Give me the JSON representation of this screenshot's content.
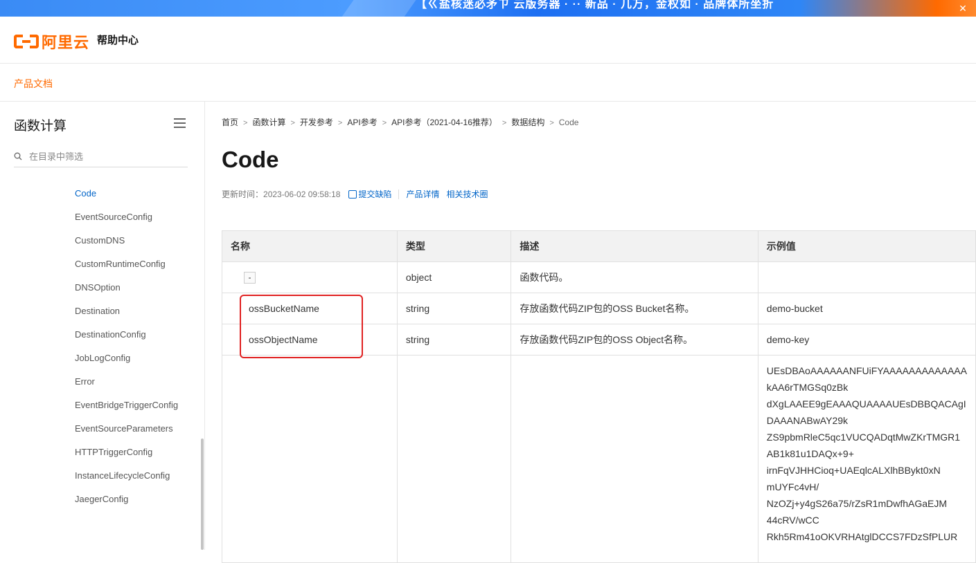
{
  "banner": {
    "text": "【ㄍ盐核迷必矛ㄗ 云版务器 · ·· 新品 · 几万，金权如 · 品牌体所坐折",
    "close_icon": "close-icon"
  },
  "header": {
    "brand": "阿里云",
    "help_center": "帮助中心"
  },
  "docsbar": {
    "product_docs": "产品文档"
  },
  "sidebar": {
    "title": "函数计算",
    "filter_placeholder": "在目录中筛选",
    "items": [
      {
        "label": "Code",
        "active": true
      },
      {
        "label": "EventSourceConfig"
      },
      {
        "label": "CustomDNS"
      },
      {
        "label": "CustomRuntimeConfig"
      },
      {
        "label": "DNSOption"
      },
      {
        "label": "Destination"
      },
      {
        "label": "DestinationConfig"
      },
      {
        "label": "JobLogConfig"
      },
      {
        "label": "Error"
      },
      {
        "label": "EventBridgeTriggerConfig"
      },
      {
        "label": "EventSourceParameters"
      },
      {
        "label": "HTTPTriggerConfig"
      },
      {
        "label": "InstanceLifecycleConfig"
      },
      {
        "label": "JaegerConfig"
      }
    ]
  },
  "breadcrumb": [
    "首页",
    "函数计算",
    "开发参考",
    "API参考",
    "API参考（2021-04-16推荐）",
    "数据结构",
    "Code"
  ],
  "page": {
    "title": "Code",
    "updated_label": "更新时间：",
    "updated_time": "2023-06-02 09:58:18",
    "submit_bug": "提交缺陷",
    "product_detail": "产品详情",
    "tech_circle": "相关技术圈"
  },
  "table": {
    "headers": [
      "名称",
      "类型",
      "描述",
      "示例值"
    ],
    "rows": [
      {
        "name": "-",
        "type": "object",
        "desc": "函数代码。",
        "example": ""
      },
      {
        "name": "ossBucketName",
        "type": "string",
        "desc": "存放函数代码ZIP包的OSS Bucket名称。",
        "example": "demo-bucket"
      },
      {
        "name": "ossObjectName",
        "type": "string",
        "desc": "存放函数代码ZIP包的OSS Object名称。",
        "example": "demo-key"
      }
    ],
    "zip_example_lines": [
      "UEsDBAoAAAAAANFUiFYAAAAAAAAAAAAA",
      "kAA6rTMGSq0zBk",
      "dXgLAAEE9gEAAAQUAAAAUEsDBBQACAgI",
      "DAAANABwAY29k",
      "ZS9pbmRleC5qc1VUCQADqtMwZKrTMGR1",
      "AB1k81u1DAQx+9+",
      "irnFqVJHHCioq+UAEqlcALXlhBBykt0xN",
      "mUYFc4vH/",
      "NzOZj+y4gS26a75/rZsR1mDwfhAGaEJM",
      "44cRV/wCC",
      "Rkh5Rm41oOKVRHAtglDCCS7FDzSfPLUR"
    ]
  }
}
